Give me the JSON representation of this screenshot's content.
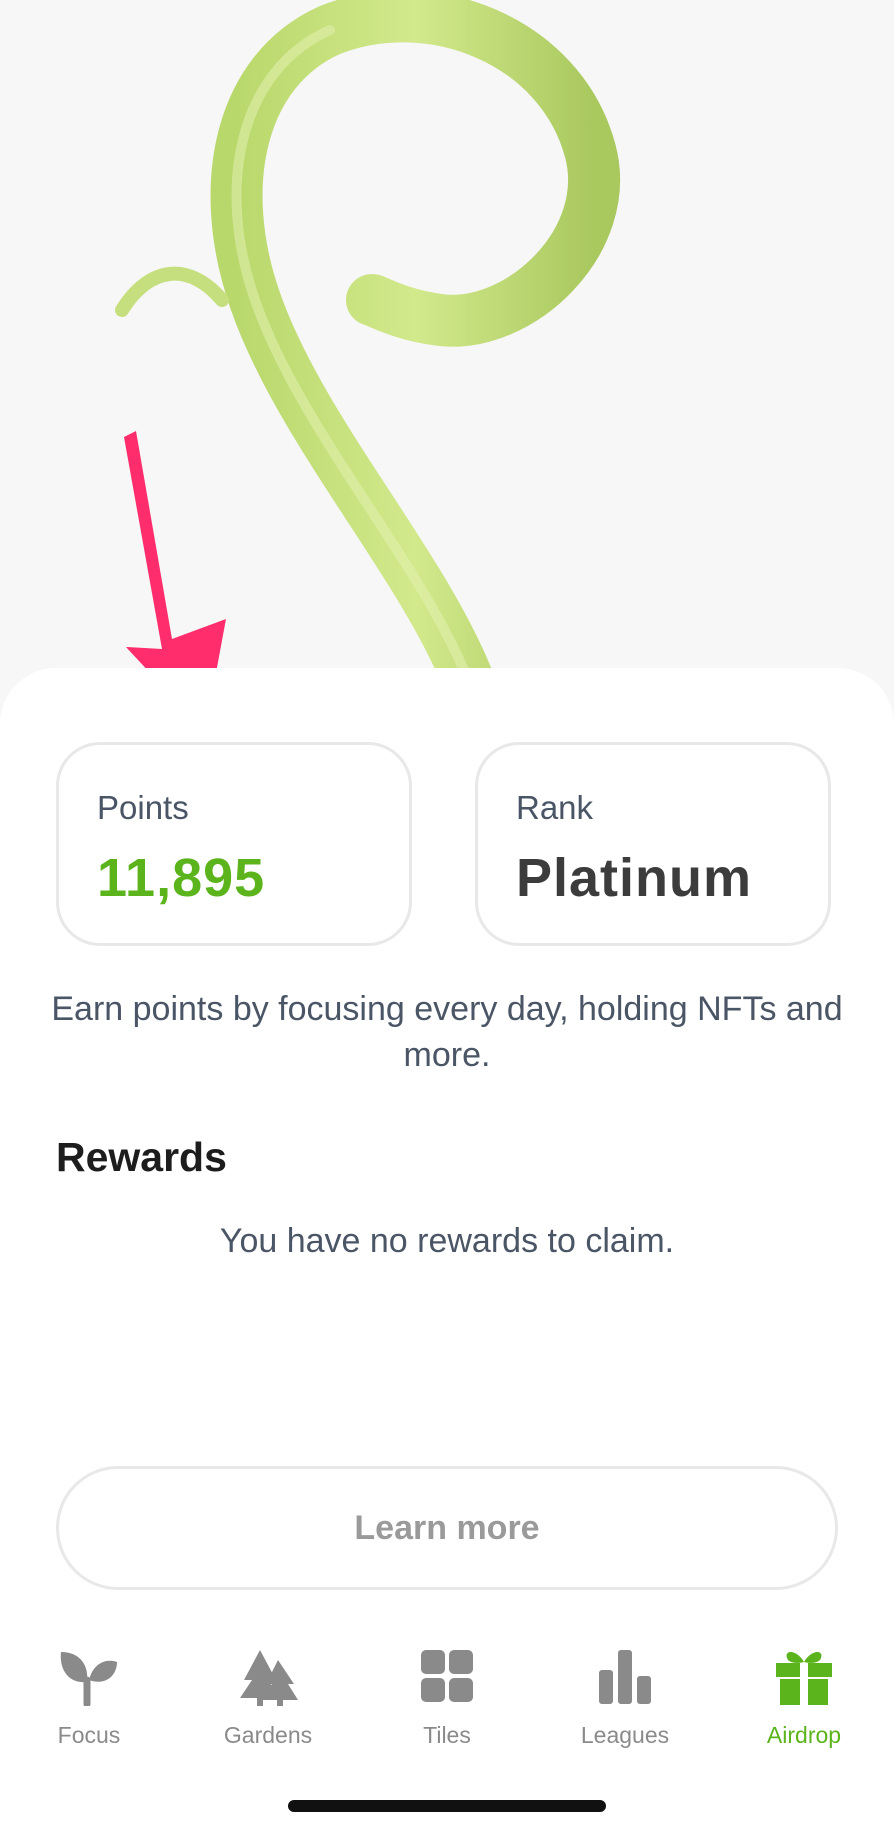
{
  "stats": {
    "points": {
      "label": "Points",
      "value": "11,895"
    },
    "rank": {
      "label": "Rank",
      "value": "Platinum"
    }
  },
  "description": "Earn points by focusing every day, holding NFTs and more.",
  "rewards": {
    "title": "Rewards",
    "empty_message": "You have no rewards to claim."
  },
  "learn_more_label": "Learn more",
  "tabs": [
    {
      "label": "Focus",
      "icon": "sprout-icon",
      "active": false
    },
    {
      "label": "Gardens",
      "icon": "trees-icon",
      "active": false
    },
    {
      "label": "Tiles",
      "icon": "grid-icon",
      "active": false
    },
    {
      "label": "Leagues",
      "icon": "bar-chart-icon",
      "active": false
    },
    {
      "label": "Airdrop",
      "icon": "gift-icon",
      "active": true
    }
  ],
  "colors": {
    "accent": "#5bb41b",
    "inactive": "#8a8a8a",
    "annotation_arrow": "#ff2d6b",
    "sprout": "#c3dd78"
  }
}
